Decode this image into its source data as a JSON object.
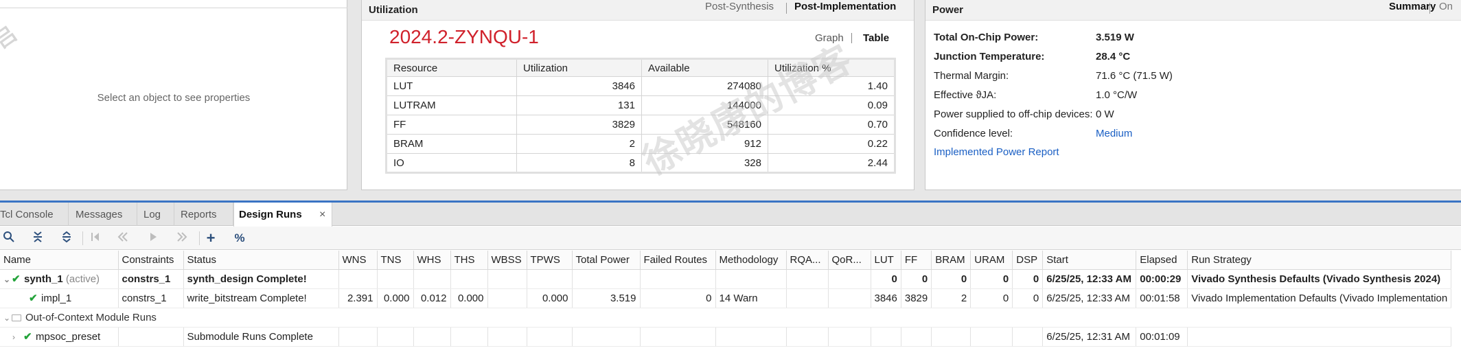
{
  "properties": {
    "empty_text": "Select an object to see properties"
  },
  "utilization": {
    "title": "Utilization",
    "tabs": [
      "Post-Synthesis",
      "Post-Implementation"
    ],
    "active_tab": "Post-Implementation",
    "part": "2024.2-ZYNQU-1",
    "view_graph": "Graph",
    "view_table": "Table",
    "columns": [
      "Resource",
      "Utilization",
      "Available",
      "Utilization %"
    ],
    "rows": [
      [
        "LUT",
        "3846",
        "274080",
        "1.40"
      ],
      [
        "LUTRAM",
        "131",
        "144000",
        "0.09"
      ],
      [
        "FF",
        "3829",
        "548160",
        "0.70"
      ],
      [
        "BRAM",
        "2",
        "912",
        "0.22"
      ],
      [
        "IO",
        "8",
        "328",
        "2.44"
      ]
    ]
  },
  "power": {
    "title": "Power",
    "tab_summary": "Summary",
    "tab_onchip": "On",
    "rows": [
      {
        "label": "Total On-Chip Power:",
        "value": "3.519 W",
        "bold": true
      },
      {
        "label": "Junction Temperature:",
        "value": "28.4 °C",
        "bold": true
      },
      {
        "label": "Thermal Margin:",
        "value": "71.6 °C (71.5 W)",
        "bold": false
      },
      {
        "label": "Effective ϑJA:",
        "value": "1.0 °C/W",
        "bold": false
      },
      {
        "label": "Power supplied to off-chip devices:",
        "value": "0 W",
        "bold": false
      },
      {
        "label": "Confidence level:",
        "value": "Medium",
        "bold": false,
        "link": true
      }
    ],
    "report_link": "Implemented Power Report"
  },
  "tabs": {
    "items": [
      "Tcl Console",
      "Messages",
      "Log",
      "Reports",
      "Design Runs"
    ],
    "active": "Design Runs",
    "close": "×"
  },
  "toolbar": {
    "icons": [
      "search-icon",
      "collapse-all-icon",
      "expand-all-icon",
      "first-icon",
      "previous-icon",
      "play-icon",
      "next-icon",
      "add-icon",
      "percent-icon"
    ],
    "plus": "+",
    "percent": "%"
  },
  "runs": {
    "columns": [
      "Name",
      "Constraints",
      "Status",
      "WNS",
      "TNS",
      "WHS",
      "THS",
      "WBSS",
      "TPWS",
      "Total Power",
      "Failed Routes",
      "Methodology",
      "RQA...",
      "QoR...",
      "LUT",
      "FF",
      "BRAM",
      "URAM",
      "DSP",
      "Start",
      "Elapsed",
      "Run Strategy"
    ],
    "synth": {
      "name": "synth_1",
      "active": "(active)",
      "constraints": "constrs_1",
      "status": "synth_design Complete!",
      "lut": "0",
      "ff": "0",
      "bram": "0",
      "uram": "0",
      "dsp": "0",
      "start": "6/25/25, 12:33 AM",
      "elapsed": "00:00:29",
      "strategy": "Vivado Synthesis Defaults (Vivado Synthesis 2024)"
    },
    "impl": {
      "name": "impl_1",
      "constraints": "constrs_1",
      "status": "write_bitstream Complete!",
      "wns": "2.391",
      "tns": "0.000",
      "whs": "0.012",
      "ths": "0.000",
      "tpws": "0.000",
      "total_power": "3.519",
      "failed_routes": "0",
      "methodology": "14 Warn",
      "lut": "3846",
      "ff": "3829",
      "bram": "2",
      "uram": "0",
      "dsp": "0",
      "start": "6/25/25, 12:33 AM",
      "elapsed": "00:01:58",
      "strategy": "Vivado Implementation Defaults (Vivado Implementation"
    },
    "ooc_group": "Out-of-Context Module Runs",
    "mpsoc": {
      "name": "mpsoc_preset",
      "status": "Submodule Runs Complete",
      "start": "6/25/25, 12:31 AM",
      "elapsed": "00:01:09"
    }
  }
}
